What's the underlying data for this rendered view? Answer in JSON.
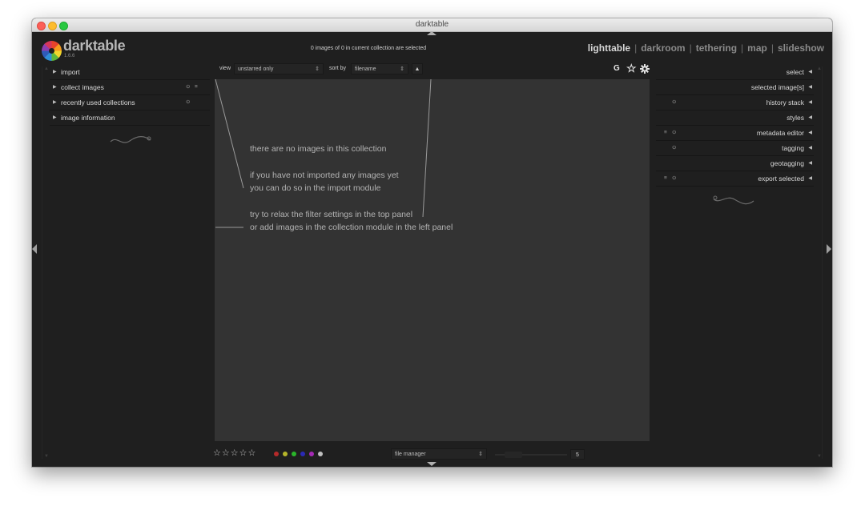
{
  "window": {
    "title": "darktable"
  },
  "app": {
    "name": "darktable",
    "version": "1.6.6"
  },
  "header": {
    "status": "0 images of 0 in current collection are selected",
    "views": [
      "lighttable",
      "darkroom",
      "tethering",
      "map",
      "slideshow"
    ],
    "active_view": "lighttable"
  },
  "left_panel": {
    "modules": [
      {
        "label": "import"
      },
      {
        "label": "collect images"
      },
      {
        "label": "recently used collections"
      },
      {
        "label": "image information"
      }
    ]
  },
  "right_panel": {
    "modules": [
      {
        "label": "select"
      },
      {
        "label": "selected image[s]"
      },
      {
        "label": "history stack"
      },
      {
        "label": "styles"
      },
      {
        "label": "metadata editor"
      },
      {
        "label": "tagging"
      },
      {
        "label": "geotagging"
      },
      {
        "label": "export selected"
      }
    ]
  },
  "top_toolbar": {
    "view_label": "view",
    "view_value": "unstarred only",
    "sort_label": "sort by",
    "sort_value": "filename",
    "sort_order_symbol": "▲",
    "grouping_symbol": "G",
    "star_overlay_symbol": "☆",
    "prefs_icon": "gear-icon"
  },
  "center": {
    "messages": [
      "there are no images in this collection",
      "if you have not imported any images yet",
      "you can do so in the import module",
      "try to relax the filter settings in the top panel",
      "or add images in the collection module in the left panel"
    ]
  },
  "bottom_bar": {
    "stars": "☆☆☆☆☆",
    "color_labels": [
      "#b52a2a",
      "#b5b52a",
      "#2ab52a",
      "#2a2ab5",
      "#a52ab5",
      "#bfbfbf"
    ],
    "layout_value": "file manager",
    "zoom_value": "5"
  }
}
